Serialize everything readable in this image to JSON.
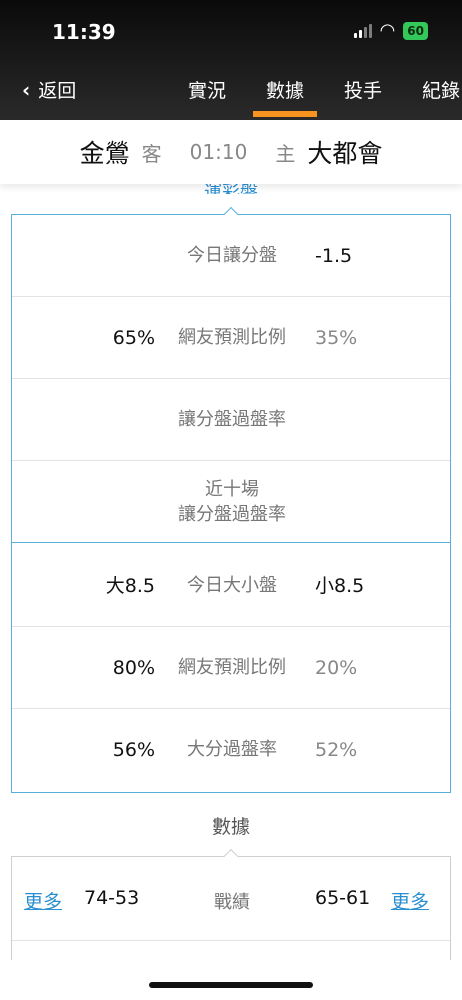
{
  "status": {
    "time": "11:39",
    "battery": "60"
  },
  "nav": {
    "back_label": "返回",
    "tabs": [
      {
        "label": "實況",
        "active": false
      },
      {
        "label": "數據",
        "active": true
      },
      {
        "label": "投手",
        "active": false
      },
      {
        "label": "紀錄",
        "active": false
      }
    ]
  },
  "match": {
    "away_team": "金鶯",
    "away_role": "客",
    "time": "01:10",
    "home_role": "主",
    "home_team": "大都會"
  },
  "odds_section": {
    "title": "運彩盤",
    "rows": [
      {
        "left": "",
        "label": "今日讓分盤",
        "right": "-1.5"
      },
      {
        "left": "65%",
        "label": "網友預測比例",
        "right": "35%"
      },
      {
        "left": "",
        "label": "讓分盤過盤率",
        "right": ""
      },
      {
        "left": "",
        "label_line1": "近十場",
        "label_line2": "讓分盤過盤率",
        "right": ""
      },
      {
        "left": "大8.5",
        "label": "今日大小盤",
        "right": "小8.5"
      },
      {
        "left": "80%",
        "label": "網友預測比例",
        "right": "20%"
      },
      {
        "left": "56%",
        "label": "大分過盤率",
        "right": "52%"
      }
    ]
  },
  "stats_section": {
    "title": "數據",
    "record_row": {
      "left_more": "更多",
      "left_value": "74-53",
      "label": "戰績",
      "right_value": "65-61",
      "right_more": "更多"
    }
  },
  "colors": {
    "accent": "#f7931e",
    "link": "#2a8fd0",
    "border": "#5ab0dc"
  }
}
